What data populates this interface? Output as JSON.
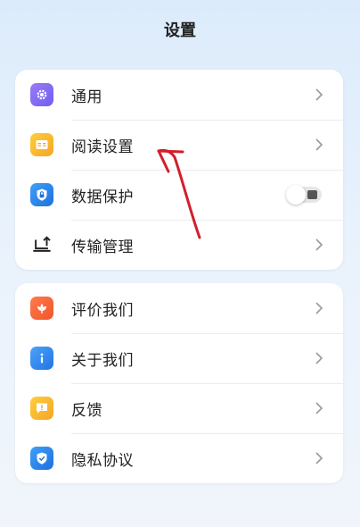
{
  "header": {
    "title": "设置"
  },
  "colors": {
    "accent": "#5b8df6",
    "annotation": "#d21f2b"
  },
  "group1": [
    {
      "label": "通用",
      "icon": "gear-icon",
      "type": "chevron"
    },
    {
      "label": "阅读设置",
      "icon": "book-icon",
      "type": "chevron"
    },
    {
      "label": "数据保护",
      "icon": "lock-shield-icon",
      "type": "toggle",
      "toggle_on": false
    },
    {
      "label": "传输管理",
      "icon": "laptop-upload-icon",
      "type": "chevron"
    }
  ],
  "group2": [
    {
      "label": "评价我们",
      "icon": "flower-icon",
      "type": "chevron"
    },
    {
      "label": "关于我们",
      "icon": "info-icon",
      "type": "chevron"
    },
    {
      "label": "反馈",
      "icon": "feedback-icon",
      "type": "chevron"
    },
    {
      "label": "隐私协议",
      "icon": "shield-check-icon",
      "type": "chevron"
    }
  ]
}
